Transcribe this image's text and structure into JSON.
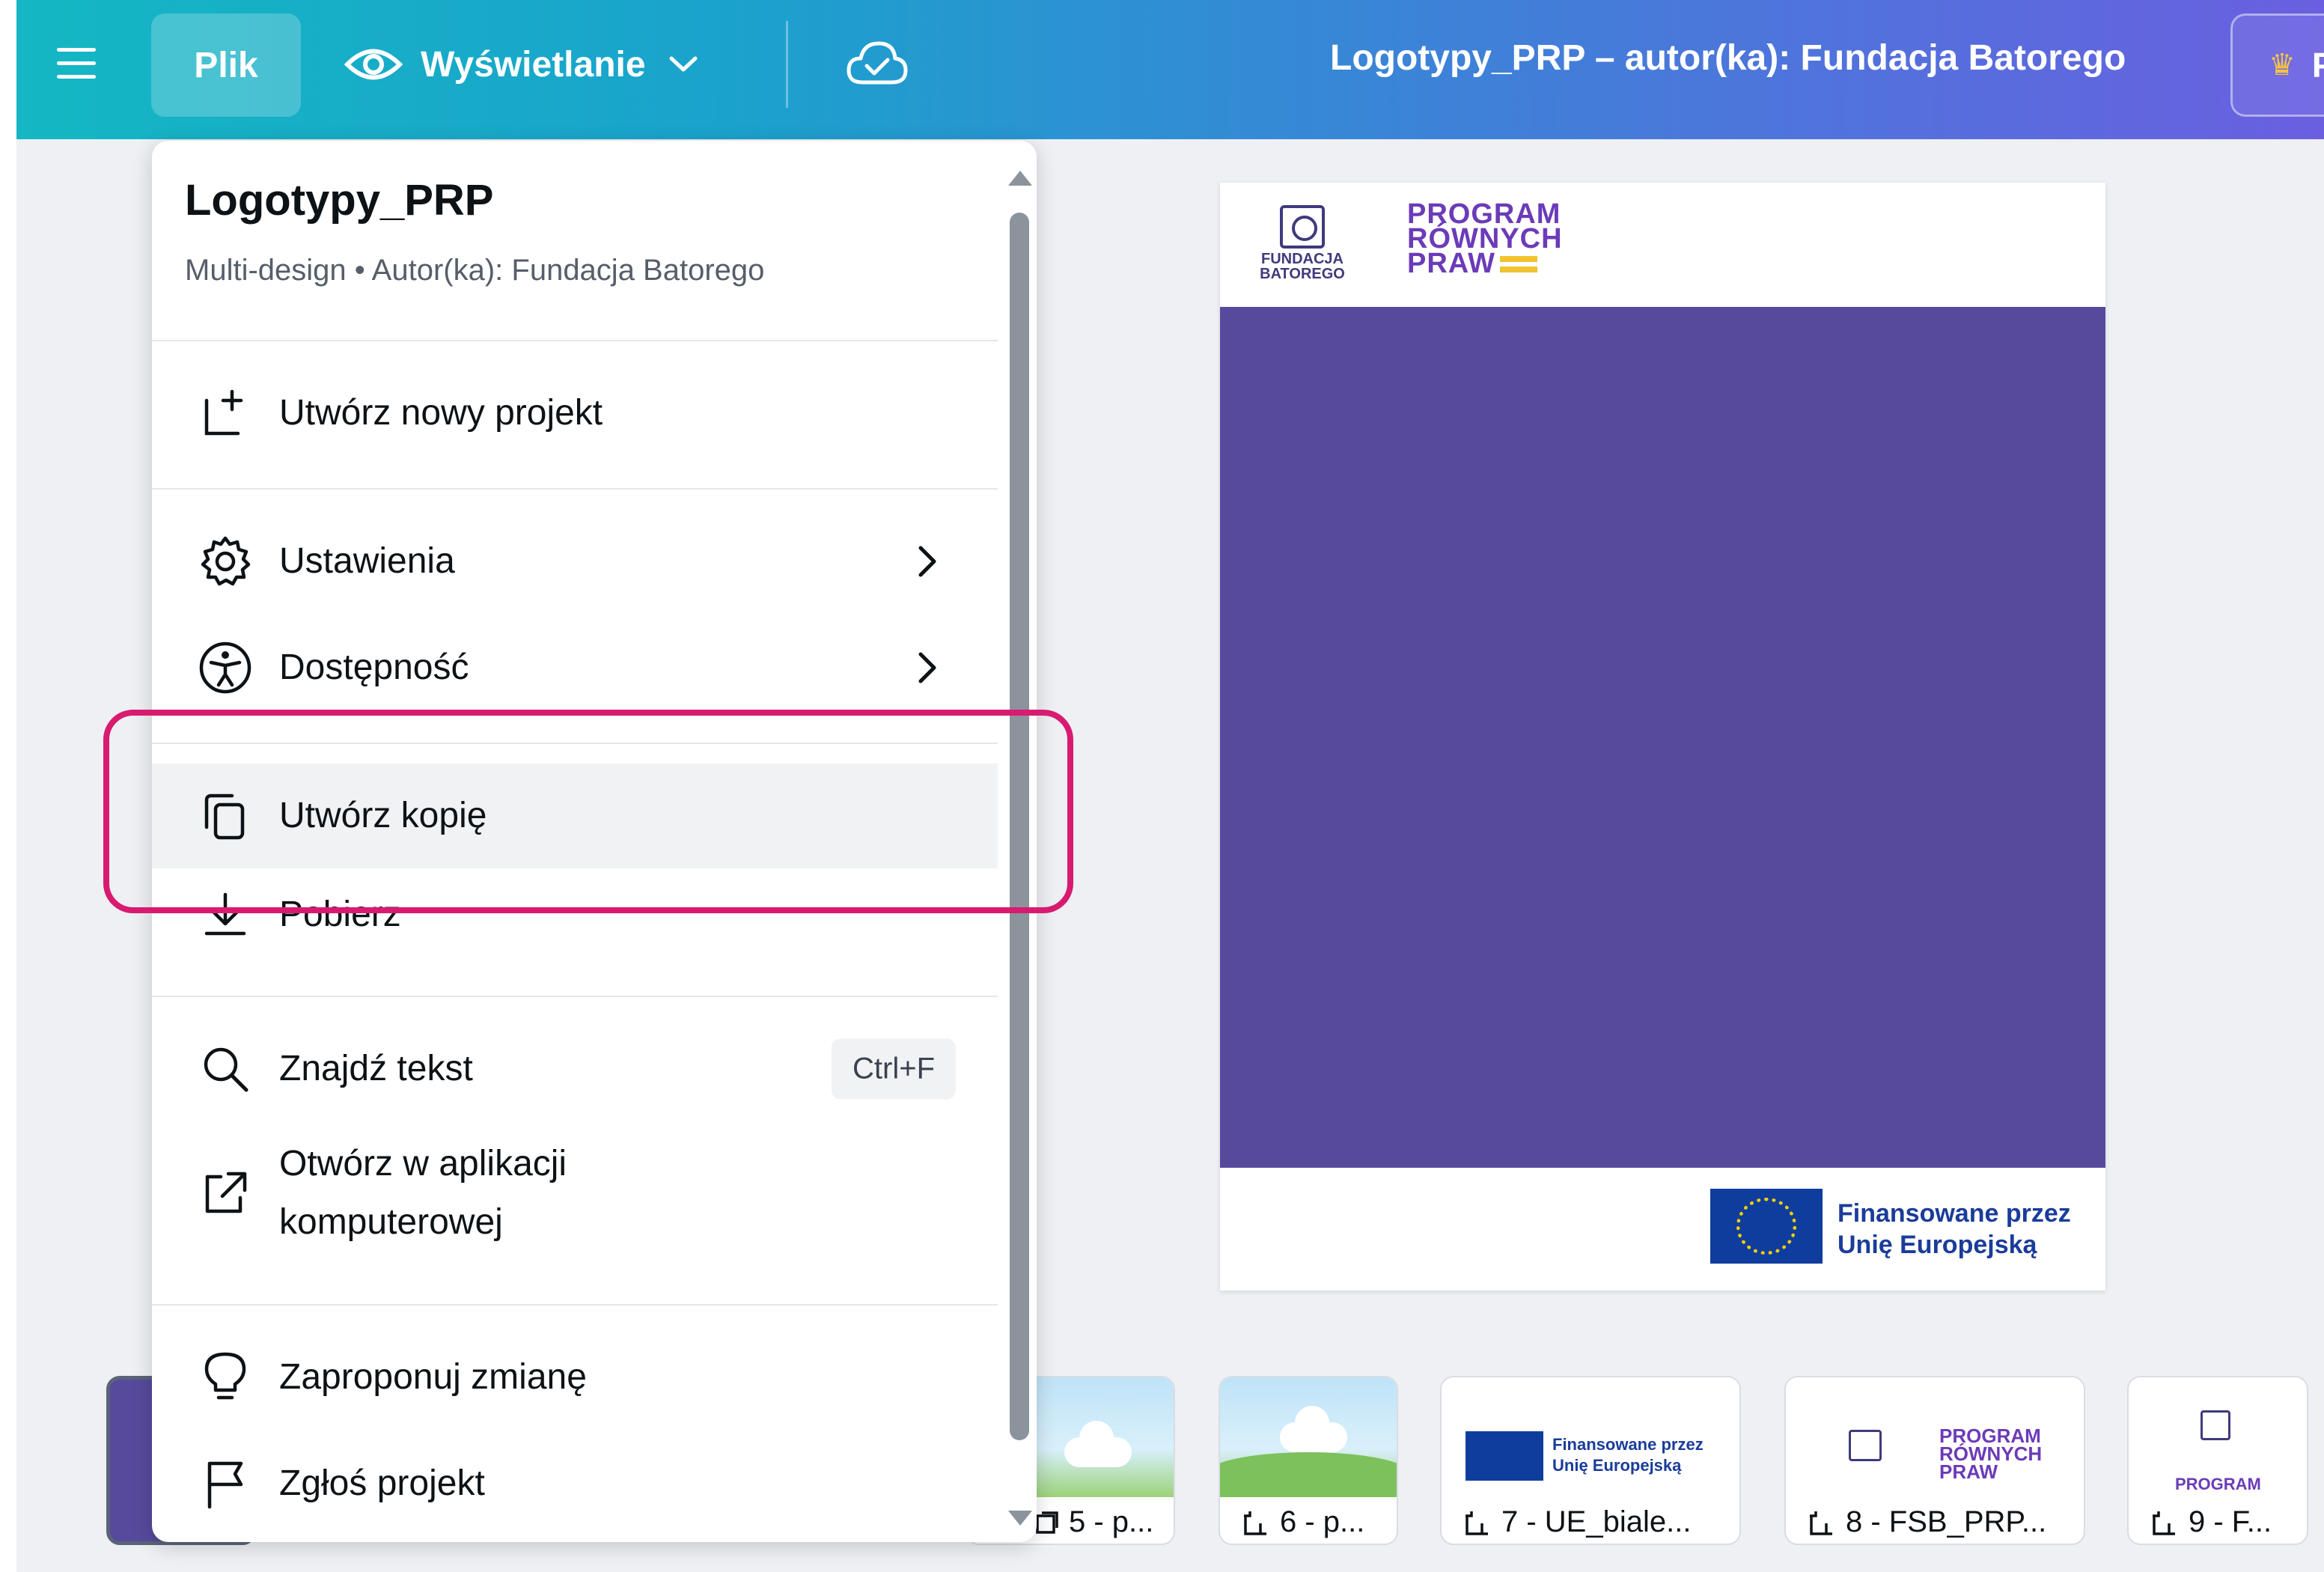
{
  "topbar": {
    "file_label": "Plik",
    "view_label": "Wyświetlanie",
    "doc_title": "Logotypy_PRP – autor(ka): Fundacja Batorego",
    "pro_label": "Pr",
    "icons": [
      "hamburger-icon",
      "eye-icon",
      "chevron-down-icon",
      "cloud-saved-icon",
      "crown-icon"
    ]
  },
  "menu": {
    "title": "Logotypy_PRP",
    "subtitle": "Multi-design • Autor(ka): Fundacja Batorego",
    "items": [
      {
        "label": "Utwórz nowy projekt",
        "icon": "new-design-icon"
      },
      {
        "label": "Ustawienia",
        "icon": "gear-icon"
      },
      {
        "label": "Dostępność",
        "icon": "accessibility-icon"
      },
      {
        "label": "Utwórz kopię",
        "icon": "copy-icon"
      },
      {
        "label": "Pobierz",
        "icon": "download-icon"
      },
      {
        "label": "Znajdź tekst",
        "icon": "search-icon",
        "shortcut": "Ctrl+F"
      },
      {
        "label": "Otwórz w aplikacji komputerowej",
        "line1": "Otwórz w aplikacji",
        "line2": "komputerowej",
        "icon": "external-link-icon"
      },
      {
        "label": "Zaproponuj zmianę",
        "icon": "lightbulb-icon"
      },
      {
        "label": "Zgłoś projekt",
        "icon": "flag-icon"
      }
    ]
  },
  "canvas": {
    "fb_logo_line1": "FUNDACJA",
    "fb_logo_line2": "BATOREGO",
    "prp_logo": [
      "PROGRAM",
      "RÓWNYCH",
      "PRAW"
    ],
    "eu_caption_line1": "Finansowane przez",
    "eu_caption_line2": "Unię Europejską",
    "panel_color": "#574a9c"
  },
  "thumbnails": [
    {
      "label": "5 - p..."
    },
    {
      "label": "6 - p..."
    },
    {
      "label": "7 - UE_biale..."
    },
    {
      "label": "8 - FSB_PRP..."
    },
    {
      "label": "9 - F..."
    }
  ],
  "colors": {
    "annotation": "#d81b70",
    "menu_highlight": "#f1f2f4"
  }
}
